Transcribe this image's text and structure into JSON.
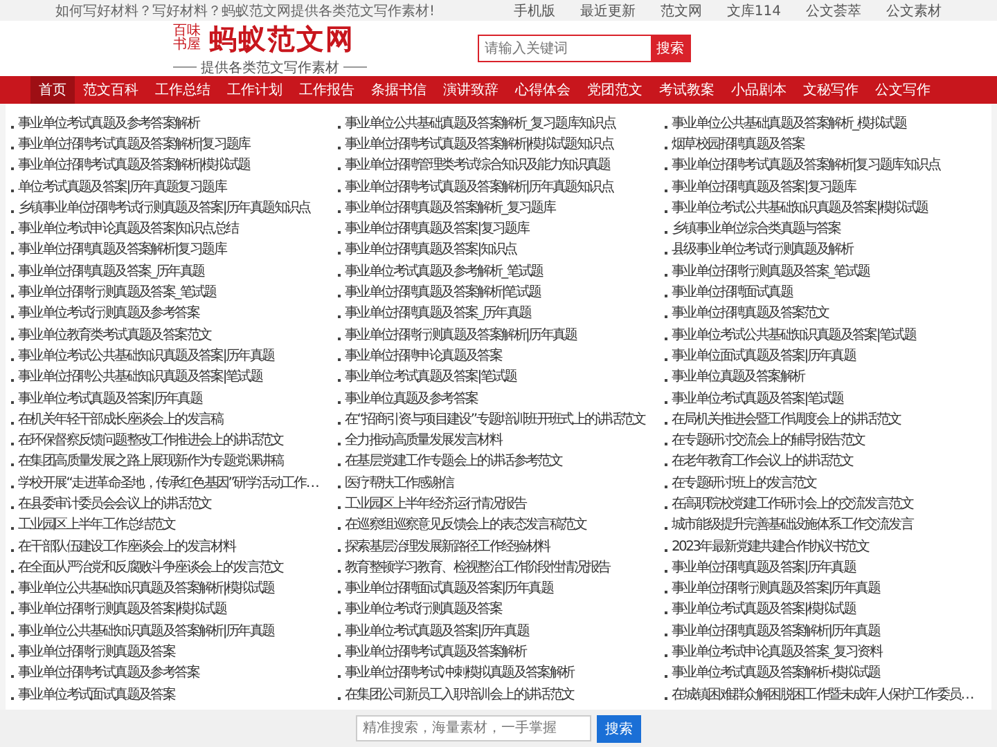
{
  "top_bar": {
    "text": "如何写好材料？写好材料？蚂蚁范文网提供各类范文写作素材!",
    "links": [
      "手机版",
      "最近更新",
      "范文网",
      "文库114",
      "公文荟萃",
      "公文素材"
    ]
  },
  "logo": {
    "stamp": "百味书屋",
    "title": "蚂蚁范文网",
    "slogan": "提供各类范文写作素材"
  },
  "search": {
    "placeholder": "请输入关键词",
    "button": "搜索"
  },
  "nav": [
    {
      "label": "首页",
      "selected": true
    },
    {
      "label": "范文百科",
      "selected": false
    },
    {
      "label": "工作总结",
      "selected": false
    },
    {
      "label": "工作计划",
      "selected": false
    },
    {
      "label": "工作报告",
      "selected": false
    },
    {
      "label": "条据书信",
      "selected": false
    },
    {
      "label": "演讲致辞",
      "selected": false
    },
    {
      "label": "心得体会",
      "selected": false
    },
    {
      "label": "党团范文",
      "selected": false
    },
    {
      "label": "考试教案",
      "selected": false
    },
    {
      "label": "小品剧本",
      "selected": false
    },
    {
      "label": "文秘写作",
      "selected": false
    },
    {
      "label": "公文写作",
      "selected": false
    }
  ],
  "articles": [
    {
      "items": [
        "事业单位考试真题及参考答案解析",
        "事业单位招聘考试真题及答案解析|复习题库",
        "事业单位招聘考试真题及答案解析|模拟试题",
        "单位考试真题及答案|历年真题复习题库",
        "乡镇事业单位招聘考试行测真题及答案|历年真题知识点",
        "事业单位考试申论真题及答案|知识点总结",
        "事业单位招聘真题及答案解析|复习题库",
        "事业单位招聘真题及答案_历年真题",
        "事业单位招聘行测真题及答案_笔试题",
        "事业单位考试行测真题及参考答案",
        "事业单位教育类考试真题及答案范文",
        "事业单位考试公共基础知识真题及答案|历年真题",
        "事业单位招聘公共基础知识真题及答案|笔试题",
        "事业单位考试真题及答案|历年真题",
        "在机关年轻干部成长座谈会上的发言稿",
        "在环保督察反馈问题整改工作推进会上的讲话范文",
        "在集团高质量发展之路上展现新作为专题党课讲稿",
        "学校开展“走进革命圣地，传承红色基因”研学活动工作…",
        "在县委审计委员会会议上的讲话范文",
        "工业园区上半年工作总结范文",
        "在干部队伍建设工作座谈会上的发言材料",
        "在全面从严治党和反腐败斗争座谈会上的发言范文",
        "事业单位公共基础知识真题及答案解析|模拟试题",
        "事业单位招聘行测真题及答案|模拟试题",
        "事业单位公共基础知识真题及答案解析|历年真题",
        "事业单位招聘行测真题及答案",
        "事业单位招聘考试真题及参考答案",
        "事业单位考试面试真题及答案"
      ]
    },
    {
      "items": [
        "事业单位公共基础真题及答案解析_复习题库知识点",
        "事业单位招聘考试真题及答案解析|模拟试题知识点",
        "事业单位招聘管理类考试综合知识及能力知识真题",
        "事业单位招聘考试真题及答案解析|历年真题知识点",
        "事业单位招聘真题及答案解析_复习题库",
        "事业单位招聘真题及答案|复习题库",
        "事业单位招聘真题及答案|知识点",
        "事业单位考试真题及参考解析_笔试题",
        "事业单位招聘真题及答案解析|笔试题",
        "事业单位招聘真题及答案_历年真题",
        "事业单位招聘行测真题及答案解析|历年真题",
        "事业单位招聘申论真题及答案",
        "事业单位考试真题及答案|笔试题",
        "事业单位真题及参考答案",
        "在“招商引资与项目建设”专题培训班开班式上的讲话范文",
        "全力推动高质量发展发言材料",
        "在基层党建工作专题会上的讲话参考范文",
        "医疗帮扶工作感谢信",
        "工业园区上半年经济运行情况报告",
        "在巡察组巡察意见反馈会上的表态发言稿范文",
        "探索基层治理发展新路径工作经验材料",
        "教育整顿学习教育、检视整治工作阶段性情况报告",
        "事业单位招聘面试真题及答案|历年真题",
        "事业单位考试行测真题及答案",
        "事业单位考试真题及答案|历年真题",
        "事业单位招聘考试真题及答案解析",
        "事业单位招聘考试冲刺模拟真题及答案解析",
        "在集团公司新员工入职培训会上的讲话范文"
      ]
    },
    {
      "items": [
        "事业单位公共基础真题及答案解析_模拟试题",
        "烟草校园招聘真题及答案",
        "事业单位招聘考试真题及答案解析|复习题库知识点",
        "事业单位招聘真题及答案|复习题库",
        "事业单位考试公共基础知识真题及答案|模拟试题",
        "乡镇事业单位综合类真题与答案",
        "县级事业单位考试行测真题及解析",
        "事业单位招聘行测真题及答案_笔试题",
        "事业单位招聘面试真题",
        "事业单位招聘真题及答案范文",
        "事业单位考试公共基础知识真题及答案|笔试题",
        "事业单位面试真题及答案|历年真题",
        "事业单位真题及答案解析",
        "事业单位考试真题及答案|笔试题",
        "在局机关推进会暨工作调度会上的讲话范文",
        "在专题研讨交流会上的辅导报告范文",
        "在老年教育工作会议上的讲话范文",
        "在专题研讨班上的发言范文",
        "在高职院校党建工作研讨会上的交流发言范文",
        "城市能级提升完善基础设施体系工作交流发言",
        "2023年最新党建共建合作协议书范文",
        "事业单位招聘真题及答案|历年真题",
        "事业单位招聘行测真题及答案|历年真题",
        "事业单位考试真题及答案|模拟试题",
        "事业单位招聘真题及答案解析|历年真题",
        "事业单位考试申论真题及答案_复习资料",
        "事业单位考试真题及答案解析-模拟试题",
        "在城镇困难群众解困脱困工作暨未成年人保护工作委员…"
      ]
    }
  ],
  "bottom_search": {
    "placeholder": "精准搜索，海量素材，一手掌握",
    "button": "搜索"
  }
}
